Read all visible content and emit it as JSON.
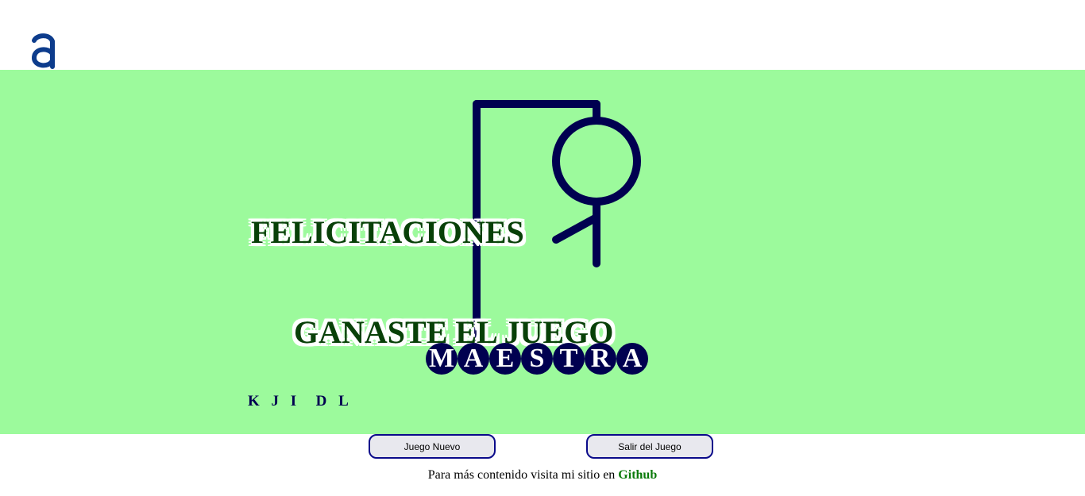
{
  "header": {
    "logo_icon": "alura-logo-icon",
    "logo_color": "#0d3c8c"
  },
  "board": {
    "background_color": "#9cfa9c",
    "figure_color": "#000050",
    "win_message": {
      "line1": "FELICITACIONES",
      "line2": "GANASTE EL JUEGO"
    },
    "word_letters": [
      "M",
      "A",
      "E",
      "S",
      "T",
      "R",
      "A"
    ],
    "wrong_letters": "K J I  D L"
  },
  "buttons": {
    "new_game": "Juego Nuevo",
    "exit_game": "Salir del Juego"
  },
  "footer": {
    "text": "Para más contenido visita mi sitio en ",
    "link": "Github"
  }
}
